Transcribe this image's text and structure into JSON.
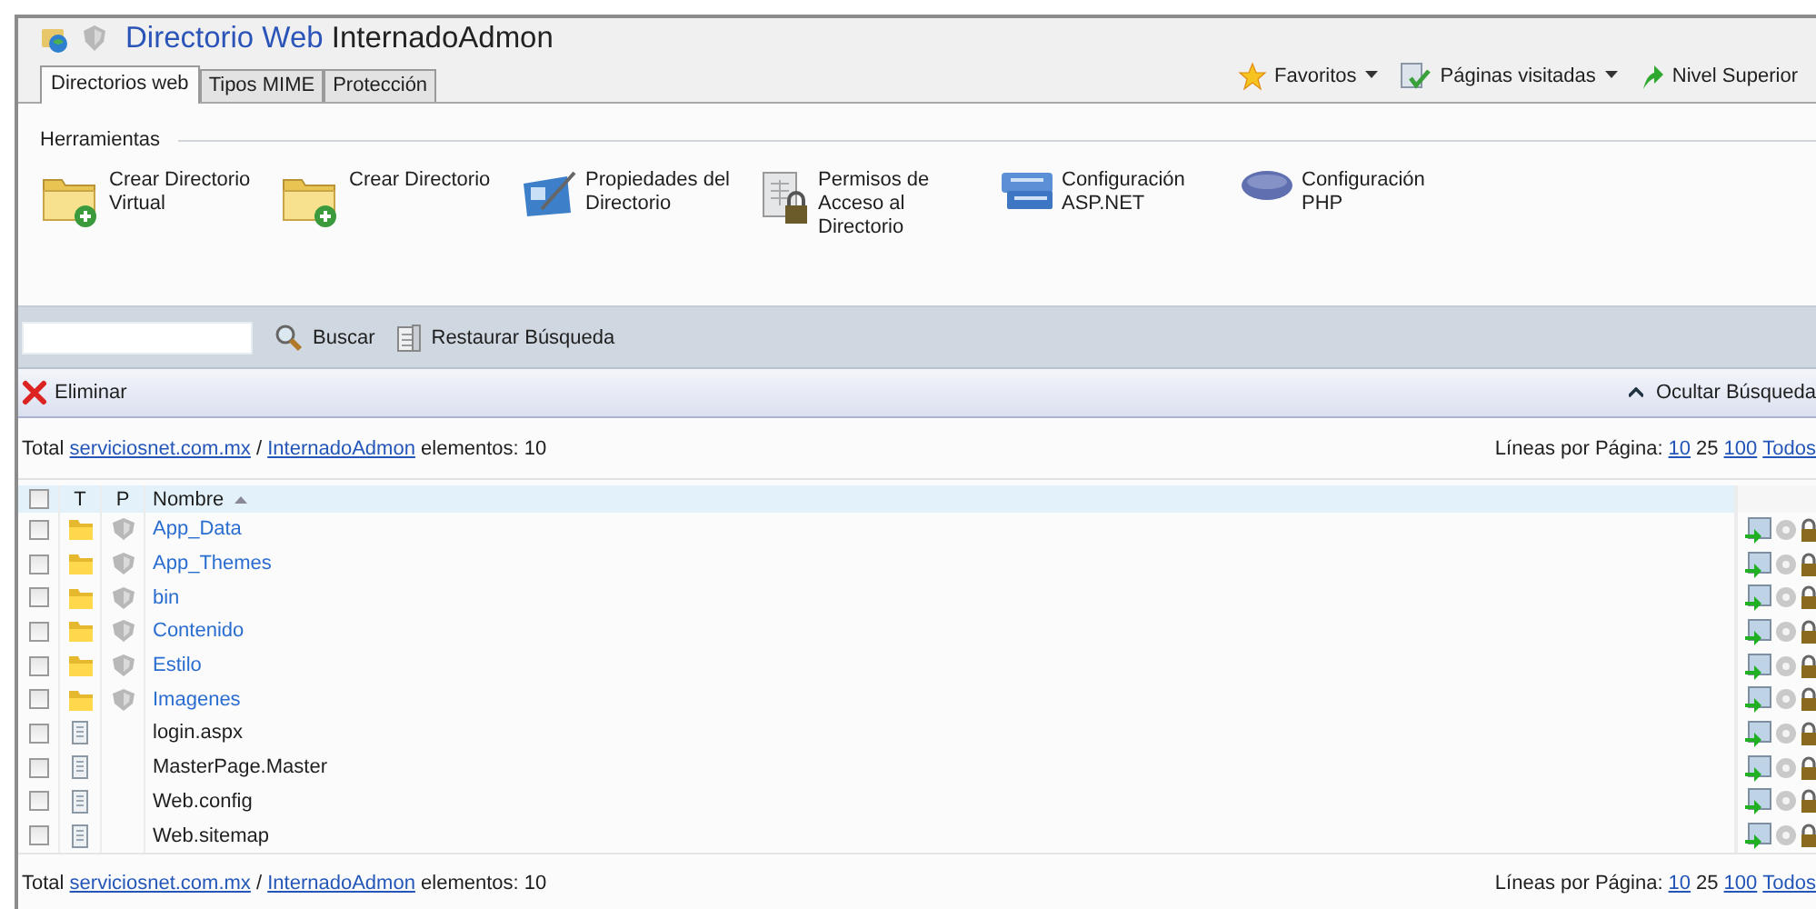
{
  "window": {
    "title_prefix": "Directorio Web",
    "title": "InternadoAdmon"
  },
  "tabs": [
    {
      "label": "Directorios web",
      "selected": true
    },
    {
      "label": "Tipos MIME",
      "selected": false
    },
    {
      "label": "Protección",
      "selected": false
    }
  ],
  "nav": [
    {
      "kind": "star",
      "label": "Favoritos",
      "dropdown": true
    },
    {
      "kind": "pages",
      "label": "Páginas visitadas",
      "dropdown": true
    },
    {
      "kind": "up",
      "label": "Nivel Superior",
      "dropdown": false
    }
  ],
  "tools": {
    "title": "Herramientas",
    "items": [
      {
        "kind": "folder-add",
        "label": "Crear Directorio Virtual"
      },
      {
        "kind": "folder-add",
        "label": "Crear Directorio"
      },
      {
        "kind": "properties",
        "label": "Propiedades del Directorio"
      },
      {
        "kind": "permissions",
        "label": "Permisos de Acceso al Directorio"
      },
      {
        "kind": "asp",
        "label": "Configuración ASP.NET"
      },
      {
        "kind": "php",
        "label": "Configuración PHP"
      }
    ]
  },
  "search": {
    "button": "Buscar",
    "restore": "Restaurar Búsqueda"
  },
  "actions": {
    "delete": "Eliminar",
    "hide_search": "Ocultar Búsqueda"
  },
  "summary_top": {
    "total": "Total",
    "site": "serviciosnet.com.mx",
    "separator": "/",
    "folder": "InternadoAdmon",
    "count": "elementos: 10",
    "lines_label": "Líneas por Página:",
    "page_sizes": [
      {
        "label": "10",
        "selected": false
      },
      {
        "label": "25",
        "selected": true
      },
      {
        "label": "100",
        "selected": false
      },
      {
        "label": "Todos",
        "selected": false
      }
    ]
  },
  "table": {
    "select_all_checked": false,
    "columns": [
      "T",
      "P",
      "Nombre"
    ],
    "sort_ascending": true,
    "rows": [
      {
        "kind": "folder",
        "name": "App_Data",
        "checked": false
      },
      {
        "kind": "folder",
        "name": "App_Themes",
        "checked": false
      },
      {
        "kind": "folder",
        "name": "bin",
        "checked": false
      },
      {
        "kind": "folder",
        "name": "Contenido",
        "checked": false
      },
      {
        "kind": "folder",
        "name": "Estilo",
        "checked": false
      },
      {
        "kind": "folder",
        "name": "Imagenes",
        "checked": false
      },
      {
        "kind": "file",
        "name": "login.aspx",
        "checked": false
      },
      {
        "kind": "file",
        "name": "MasterPage.Master",
        "checked": false
      },
      {
        "kind": "file",
        "name": "Web.config",
        "checked": false
      },
      {
        "kind": "file",
        "name": "Web.sitemap",
        "checked": false
      }
    ]
  },
  "summary_bottom": {
    "total": "Total",
    "site": "serviciosnet.com.mx",
    "separator": "/",
    "folder": "InternadoAdmon",
    "count": "elementos: 10",
    "lines_label": "Líneas por Página:",
    "page_sizes": [
      {
        "label": "10",
        "selected": false
      },
      {
        "label": "25",
        "selected": true
      },
      {
        "label": "100",
        "selected": false
      },
      {
        "label": "Todos",
        "selected": false
      }
    ]
  }
}
